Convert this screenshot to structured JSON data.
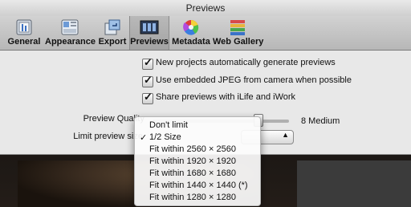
{
  "window": {
    "title": "Previews"
  },
  "toolbar": {
    "tabs": [
      {
        "label": "General",
        "icon": "general-prefs-icon"
      },
      {
        "label": "Appearance",
        "icon": "appearance-icon"
      },
      {
        "label": "Export",
        "icon": "export-icon"
      },
      {
        "label": "Previews",
        "icon": "previews-filmstrip-icon",
        "selected": true
      },
      {
        "label": "Metadata",
        "icon": "color-wheel-icon"
      },
      {
        "label": "Web Gallery",
        "icon": "web-gallery-icon"
      }
    ]
  },
  "settings": {
    "checkboxes": [
      {
        "label": "New projects automatically generate previews",
        "checked": true
      },
      {
        "label": "Use embedded JPEG from camera when possible",
        "checked": true
      },
      {
        "label": "Share previews with iLife and iWork",
        "checked": true
      }
    ],
    "quality_label": "Preview Quality",
    "quality_value": "8 Medium",
    "quality_level": 0.8,
    "limit_label": "Limit preview size"
  },
  "dropdown_menu": {
    "items": [
      {
        "label": "Don't limit",
        "checked": false
      },
      {
        "label": "1/2 Size",
        "checked": true
      },
      {
        "label": "Fit within 2560 × 2560",
        "checked": false
      },
      {
        "label": "Fit within 1920 × 1920",
        "checked": false
      },
      {
        "label": "Fit within 1680 × 1680",
        "checked": false
      },
      {
        "label": "Fit within 1440 × 1440 (*)",
        "checked": false
      },
      {
        "label": "Fit within 1280 × 1280",
        "checked": false
      }
    ],
    "check_glyph": "✓"
  }
}
